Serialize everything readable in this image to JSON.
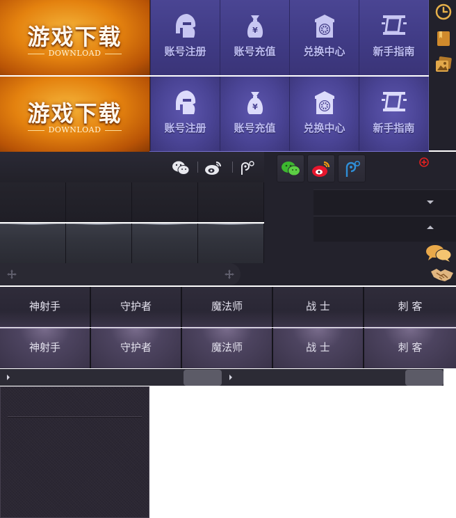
{
  "banners": [
    {
      "download": {
        "title": "游戏下载",
        "subtitle": "DOWNLOAD"
      },
      "nav": [
        {
          "label": "账号注册",
          "icon": "helmet-icon"
        },
        {
          "label": "账号充值",
          "icon": "money-bag-icon"
        },
        {
          "label": "兑换中心",
          "icon": "shop-wheel-icon"
        },
        {
          "label": "新手指南",
          "icon": "scroll-guide-icon"
        }
      ]
    },
    {
      "download": {
        "title": "游戏下载",
        "subtitle": "DOWNLOAD"
      },
      "nav": [
        {
          "label": "账号注册",
          "icon": "helmet-icon"
        },
        {
          "label": "账号充值",
          "icon": "money-bag-icon"
        },
        {
          "label": "兑换中心",
          "icon": "shop-wheel-icon"
        },
        {
          "label": "新手指南",
          "icon": "scroll-guide-icon"
        }
      ]
    }
  ],
  "side_icons": [
    "clock-icon",
    "bookmark-icon",
    "gallery-icon"
  ],
  "share": {
    "icons": [
      "wechat-icon",
      "weibo-icon",
      "tencent-weibo-icon"
    ],
    "colored_icons": [
      "wechat-color-icon",
      "weibo-color-icon",
      "tencent-weibo-color-icon"
    ],
    "colors": {
      "wechat": "#3cb72f",
      "weibo": "#e6162d",
      "tencent": "#2f8fd8",
      "add": "#e02020"
    }
  },
  "classes": {
    "row1": [
      "神射手",
      "守护者",
      "魔法师",
      "战  士",
      "刺  客"
    ],
    "row2": [
      "神射手",
      "守护者",
      "魔法师",
      "战  士",
      "刺  客"
    ]
  },
  "colors": {
    "download_orange": "#e4820f",
    "nav_purple": "#403b85",
    "dark_bg": "#23222c"
  }
}
